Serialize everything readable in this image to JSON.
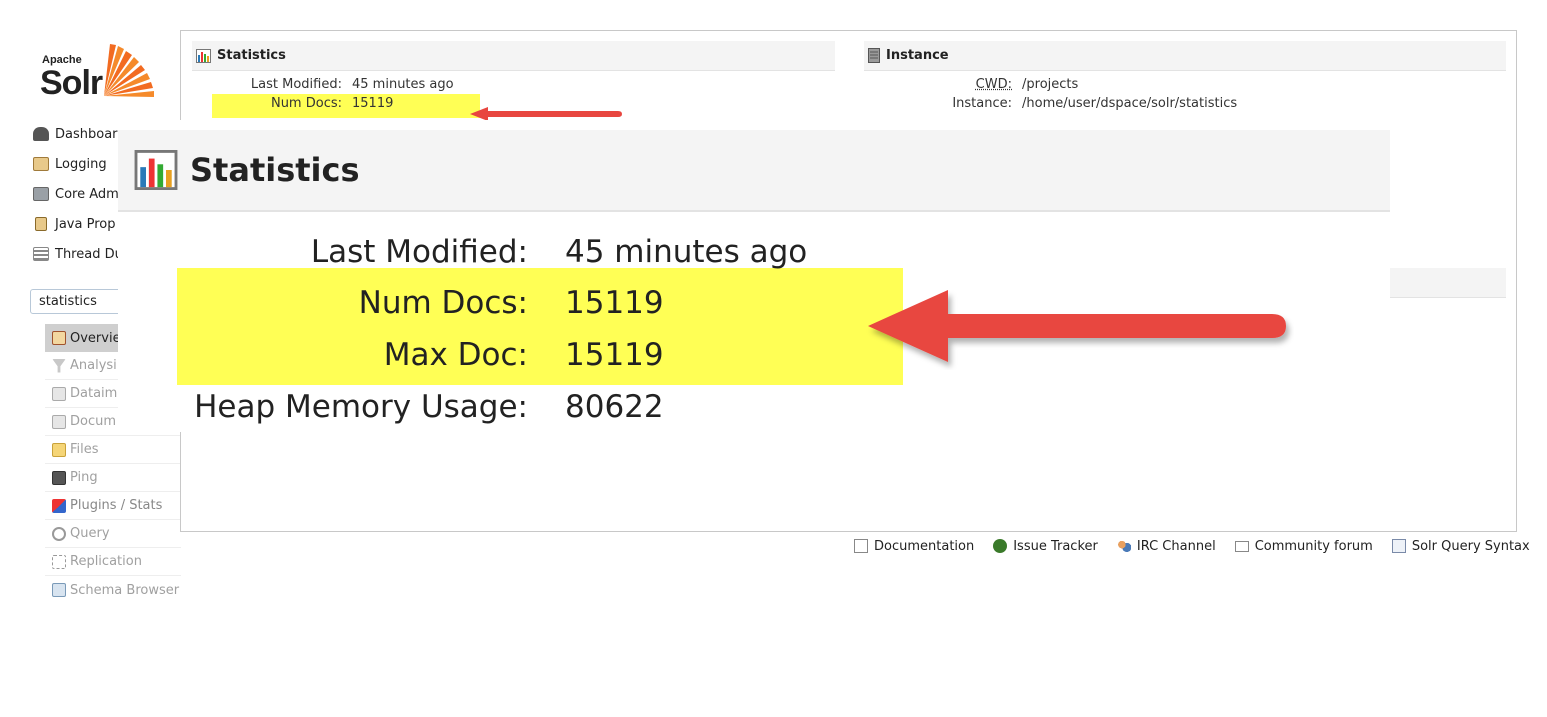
{
  "logo": {
    "apache": "Apache",
    "solr": "Solr"
  },
  "nav": [
    {
      "label": "Dashboar",
      "icon": "dashboard-icon"
    },
    {
      "label": "Logging",
      "icon": "logging-icon"
    },
    {
      "label": "Core Adm",
      "icon": "core-admin-icon"
    },
    {
      "label": "Java Prop",
      "icon": "java-properties-icon"
    },
    {
      "label": "Thread Du",
      "icon": "thread-dump-icon"
    }
  ],
  "core_selector": {
    "value": "statistics"
  },
  "core_menu": [
    {
      "label": "Overvie",
      "icon": "home-icon"
    },
    {
      "label": "Analysi",
      "icon": "funnel-icon"
    },
    {
      "label": "Dataim",
      "icon": "dataimport-icon"
    },
    {
      "label": "Docum",
      "icon": "documents-icon"
    },
    {
      "label": "Files",
      "icon": "folder-icon"
    },
    {
      "label": "Ping",
      "icon": "ping-icon"
    },
    {
      "label": "Plugins / Stats",
      "icon": "plugins-icon"
    },
    {
      "label": "Query",
      "icon": "query-icon"
    },
    {
      "label": "Replication",
      "icon": "replication-icon"
    },
    {
      "label": "Schema Browser",
      "icon": "schema-icon"
    }
  ],
  "statistics": {
    "title": "Statistics",
    "last_modified_label": "Last Modified:",
    "last_modified_value": "45 minutes ago",
    "num_docs_label": "Num Docs:",
    "num_docs_value": "15119",
    "max_doc_label": "Max Doc:",
    "max_doc_value": "15119",
    "heap_label": "Heap Memory Usage:",
    "heap_value": "80622"
  },
  "instance": {
    "title": "Instance",
    "cwd_label": "CWD:",
    "cwd_value": "/projects",
    "instance_label": "Instance:",
    "instance_value": "/home/user/dspace/solr/statistics"
  },
  "footer": [
    {
      "label": "Documentation",
      "icon": "document-icon"
    },
    {
      "label": "Issue Tracker",
      "icon": "bug-icon"
    },
    {
      "label": "IRC Channel",
      "icon": "irc-icon"
    },
    {
      "label": "Community forum",
      "icon": "mail-icon"
    },
    {
      "label": "Solr Query Syntax",
      "icon": "syntax-icon"
    }
  ],
  "colors": {
    "highlight": "#ffff55",
    "arrow": "#e8463f",
    "selected_menu": "#cfcfcf"
  }
}
